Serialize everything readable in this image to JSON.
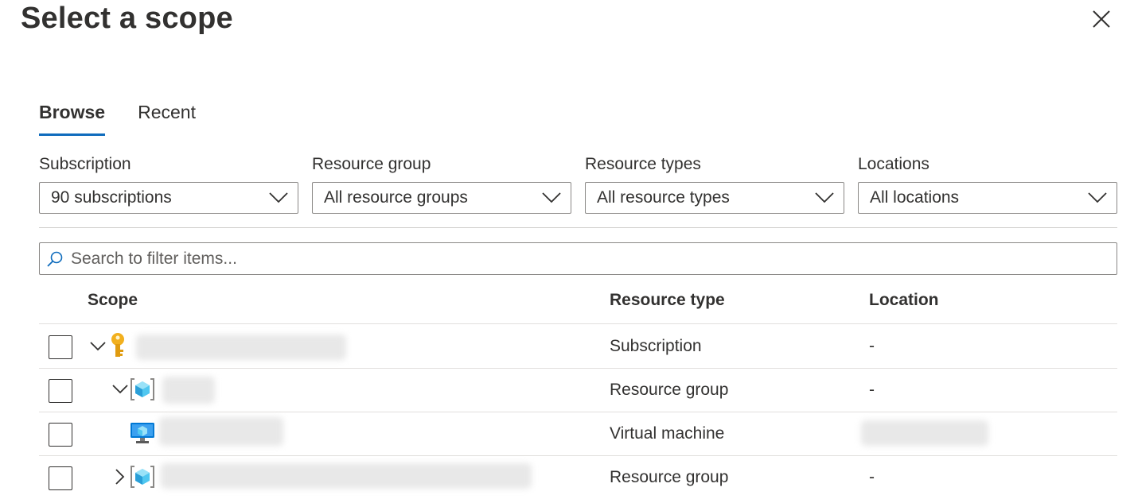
{
  "dialog": {
    "title": "Select a scope",
    "close_icon": "close-icon"
  },
  "tabs": [
    {
      "label": "Browse",
      "active": true
    },
    {
      "label": "Recent",
      "active": false
    }
  ],
  "filters": [
    {
      "label": "Subscription",
      "value": "90 subscriptions"
    },
    {
      "label": "Resource group",
      "value": "All resource groups"
    },
    {
      "label": "Resource types",
      "value": "All resource types"
    },
    {
      "label": "Locations",
      "value": "All locations"
    }
  ],
  "search": {
    "placeholder": "Search to filter items...",
    "icon": "search-icon"
  },
  "table": {
    "columns": [
      "Scope",
      "Resource type",
      "Location"
    ],
    "rows": [
      {
        "resource_type": "Subscription",
        "location": "-",
        "icon": "key-icon",
        "expander": "chevron-down-icon"
      },
      {
        "resource_type": "Resource group",
        "location": "-",
        "icon": "resource-group-icon",
        "expander": "chevron-down-icon"
      },
      {
        "resource_type": "Virtual machine",
        "location": "",
        "icon": "virtual-machine-icon"
      },
      {
        "resource_type": "Resource group",
        "location": "-",
        "icon": "resource-group-icon",
        "expander": "chevron-right-icon"
      }
    ]
  },
  "colors": {
    "accent": "#0f6cbd",
    "text": "#323130",
    "border": "#8a8886",
    "key": "#f2b01e",
    "cube": "#50c7f0"
  }
}
